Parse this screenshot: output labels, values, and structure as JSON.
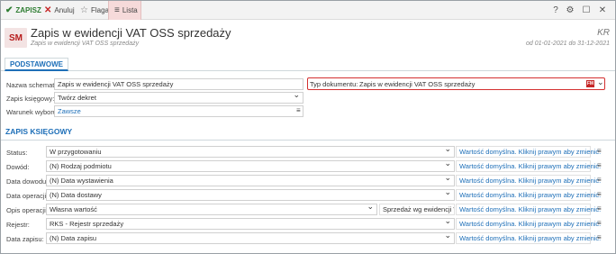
{
  "toolbar": {
    "save": "ZAPISZ",
    "cancel": "Anuluj",
    "flag": "Flaga",
    "list": "Lista"
  },
  "header": {
    "avatar": "SM",
    "title": "Zapis w ewidencji VAT OSS sprzedaży",
    "subtitle": "Zapis w ewidencji VAT OSS sprzedaży",
    "code": "KR",
    "dates": "od 01-01-2021 do 31-12-2021"
  },
  "tab": "PODSTAWOWE",
  "basic": {
    "nazwa_label": "Nazwa schematu:",
    "nazwa_value": "Zapis w ewidencji VAT OSS sprzedaży",
    "zapis_label": "Zapis księgowy:",
    "zapis_value": "Twórz dekret",
    "warunek_label": "Warunek wyboru:",
    "warunek_value": "Zawsze",
    "typ_label": "Typ dokumentu:",
    "typ_value": "Zapis w ewidencji VAT OSS sprzedaży",
    "typ_badge": "FM"
  },
  "section_title": "ZAPIS KSIĘGOWY",
  "hint_text": "Wartość domyślna. Kliknij prawym aby zmienić.",
  "rows": [
    {
      "label": "Status:",
      "value": "W przygotowaniu"
    },
    {
      "label": "Dowód:",
      "value": "(N) Rodzaj podmiotu"
    },
    {
      "label": "Data dowodu:",
      "value": "(N) Data wystawienia"
    },
    {
      "label": "Data operacji:",
      "value": "(N) Data dostawy"
    },
    {
      "label": "Opis operacji:",
      "value": "Własna wartość",
      "extra": "Sprzedaż wg ewidencji VAT"
    },
    {
      "label": "Rejestr:",
      "value": "RKS - Rejestr sprzedaży"
    },
    {
      "label": "Data zapisu:",
      "value": "(N) Data zapisu"
    }
  ]
}
